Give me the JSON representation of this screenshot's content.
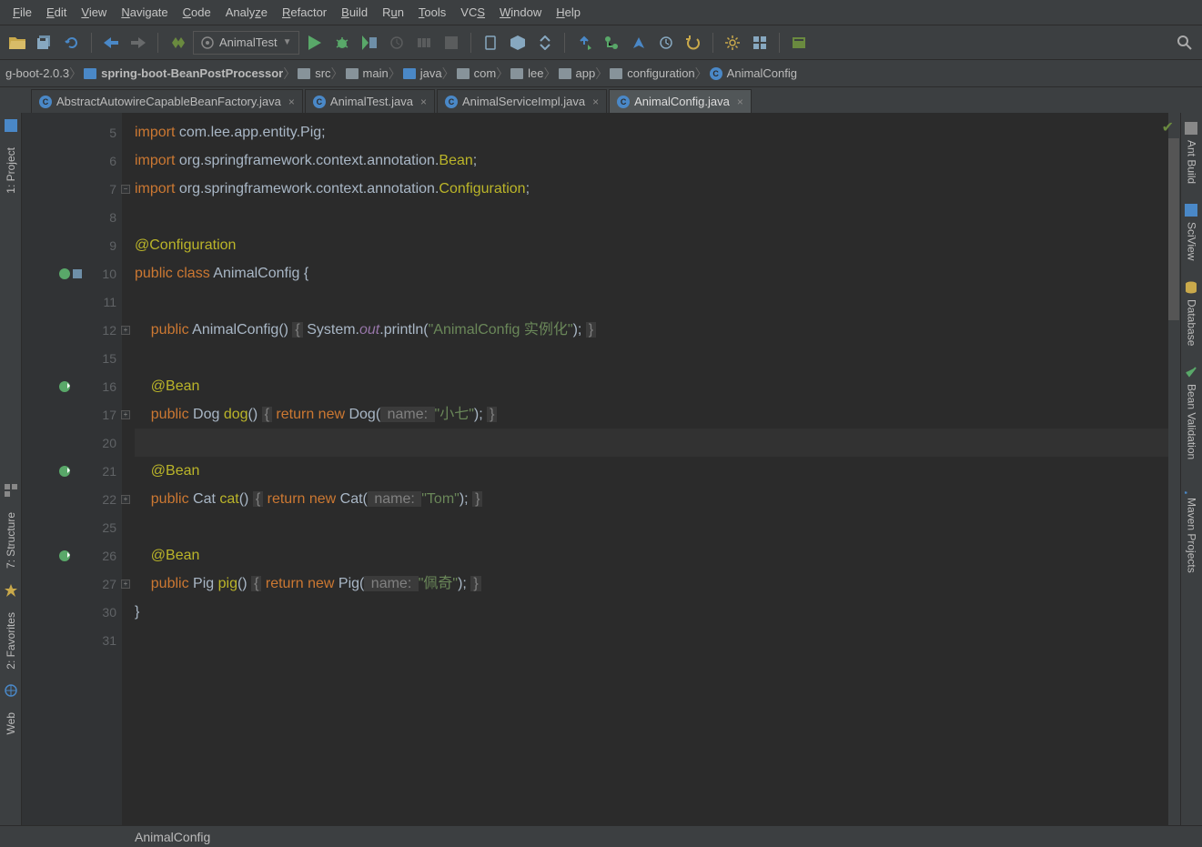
{
  "menu": [
    "File",
    "Edit",
    "View",
    "Navigate",
    "Code",
    "Analyze",
    "Refactor",
    "Build",
    "Run",
    "Tools",
    "VCS",
    "Window",
    "Help"
  ],
  "runConfig": {
    "label": "AnimalTest"
  },
  "breadcrumb": [
    {
      "label": "g-boot-2.0.3"
    },
    {
      "label": "spring-boot-BeanPostProcessor",
      "blue": true
    },
    {
      "label": "src"
    },
    {
      "label": "main"
    },
    {
      "label": "java",
      "blue": true
    },
    {
      "label": "com"
    },
    {
      "label": "lee"
    },
    {
      "label": "app"
    },
    {
      "label": "configuration"
    },
    {
      "label": "AnimalConfig",
      "cls": true
    }
  ],
  "tabs": [
    {
      "label": "AbstractAutowireCapableBeanFactory.java",
      "active": false
    },
    {
      "label": "AnimalTest.java",
      "active": false
    },
    {
      "label": "AnimalServiceImpl.java",
      "active": false
    },
    {
      "label": "AnimalConfig.java",
      "active": true
    }
  ],
  "leftTools": [
    {
      "label": "1: Project"
    },
    {
      "label": "7: Structure"
    },
    {
      "label": "2: Favorites"
    },
    {
      "label": "Web"
    }
  ],
  "rightTools": [
    {
      "label": "Ant Build",
      "icon": "ant"
    },
    {
      "label": "SciView",
      "icon": "sci"
    },
    {
      "label": "Database",
      "icon": "db"
    },
    {
      "label": "Bean Validation",
      "icon": "check"
    },
    {
      "label": "Maven Projects",
      "icon": "maven"
    }
  ],
  "editor": {
    "lineNumbers": [
      "5",
      "6",
      "7",
      "8",
      "9",
      "10",
      "11",
      "12",
      "15",
      "16",
      "17",
      "20",
      "21",
      "22",
      "25",
      "26",
      "27",
      "30",
      "31"
    ],
    "crumb": "AnimalConfig"
  },
  "code": {
    "l5a": "import ",
    "l5b": "com.lee.app.entity.Pig;",
    "l6a": "import ",
    "l6b": "org.springframework.context.annotation.",
    "l6c": "Bean",
    "l6d": ";",
    "l7a": "import ",
    "l7b": "org.springframework.context.annotation.",
    "l7c": "Configuration",
    "l7d": ";",
    "l9": "@Configuration",
    "l10a": "public class ",
    "l10b": "AnimalConfig {",
    "l12a": "    public ",
    "l12b": "AnimalConfig",
    "l12c": "() ",
    "l12d": "{",
    "l12e": " System.",
    "l12f": "out",
    "l12g": ".println(",
    "l12h": "\"AnimalConfig 实例化\"",
    "l12i": "); ",
    "l12j": "}",
    "l16": "    @Bean",
    "l17a": "    public ",
    "l17b": "Dog ",
    "l17c": "dog",
    "l17d": "() ",
    "l17e": "{",
    "l17f": " return new ",
    "l17g": "Dog(",
    "l17h": " name: ",
    "l17i": "\"小七\"",
    "l17j": "); ",
    "l17k": "}",
    "l21": "    @Bean",
    "l22a": "    public ",
    "l22b": "Cat ",
    "l22c": "cat",
    "l22d": "() ",
    "l22e": "{",
    "l22f": " return new ",
    "l22g": "Cat(",
    "l22h": " name: ",
    "l22i": "\"Tom\"",
    "l22j": "); ",
    "l22k": "}",
    "l26": "    @Bean",
    "l27a": "    public ",
    "l27b": "Pig ",
    "l27c": "pig",
    "l27d": "() ",
    "l27e": "{",
    "l27f": " return new ",
    "l27g": "Pig(",
    "l27h": " name: ",
    "l27i": "\"佩奇\"",
    "l27j": "); ",
    "l27k": "}",
    "l30": "}"
  }
}
